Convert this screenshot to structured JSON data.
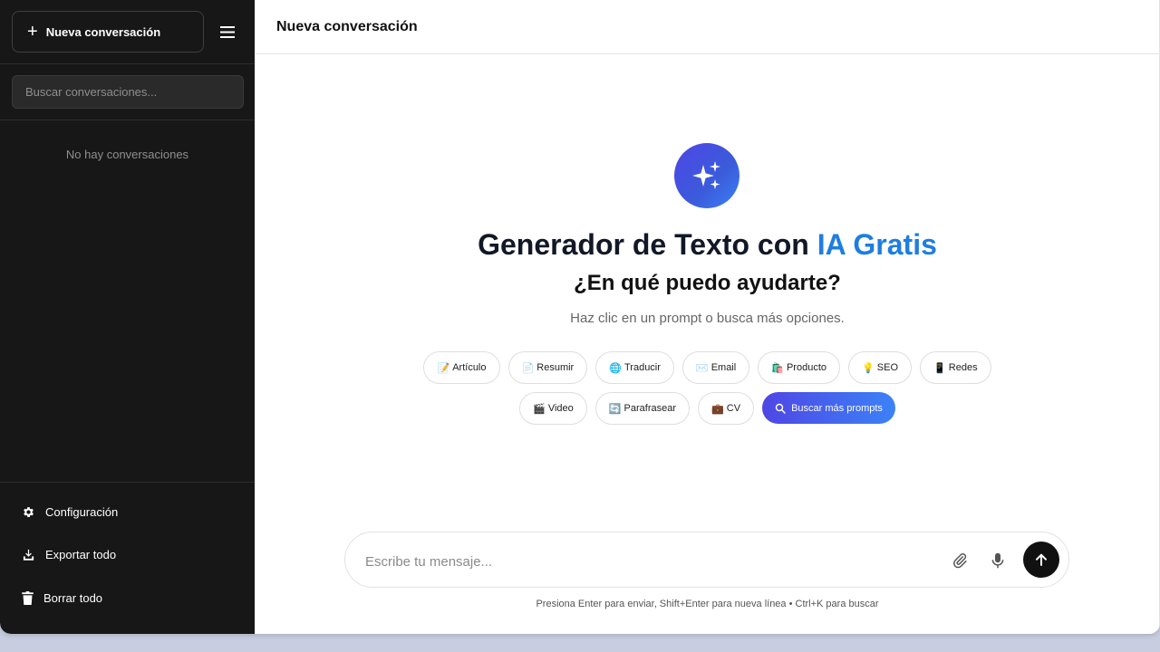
{
  "sidebar": {
    "new_chat_label": "Nueva conversación",
    "search_placeholder": "Buscar conversaciones...",
    "empty_text": "No hay conversaciones",
    "footer_items": [
      {
        "label": "Configuración",
        "icon": "gear-icon"
      },
      {
        "label": "Exportar todo",
        "icon": "download-icon"
      },
      {
        "label": "Borrar todo",
        "icon": "trash-icon"
      }
    ]
  },
  "header": {
    "title": "Nueva conversación"
  },
  "hero": {
    "logo_icon": "sparkles-icon",
    "headline_prefix": "Generador de Texto con ",
    "headline_accent": "IA Gratis",
    "subtitle": "¿En qué puedo ayudarte?",
    "hint": "Haz clic en un prompt o busca más opciones."
  },
  "prompts_row1": [
    {
      "emoji": "📝",
      "label": "Artículo"
    },
    {
      "emoji": "📄",
      "label": "Resumir"
    },
    {
      "emoji": "🌐",
      "label": "Traducir"
    },
    {
      "emoji": "✉️",
      "label": "Email"
    },
    {
      "emoji": "🛍️",
      "label": "Producto"
    },
    {
      "emoji": "💡",
      "label": "SEO"
    },
    {
      "emoji": "📱",
      "label": "Redes"
    }
  ],
  "prompts_row2": [
    {
      "emoji": "🎬",
      "label": "Video"
    },
    {
      "emoji": "🔄",
      "label": "Parafrasear"
    },
    {
      "emoji": "💼",
      "label": "CV"
    }
  ],
  "search_prompts_label": "Buscar más prompts",
  "composer": {
    "placeholder": "Escribe tu mensaje...",
    "footnote": "Presiona Enter para enviar, Shift+Enter para nueva línea • Ctrl+K para buscar"
  },
  "colors": {
    "accent": "#1e7ee0",
    "sidebar_bg": "#171717",
    "brand_gradient_start": "#4f46e5",
    "brand_gradient_end": "#3b82f6"
  }
}
